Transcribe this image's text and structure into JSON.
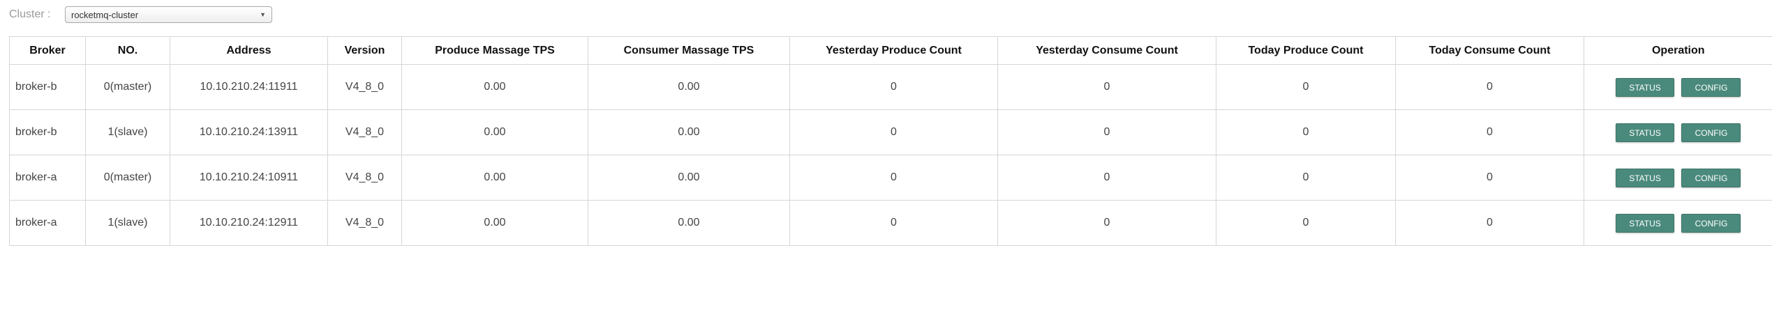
{
  "filter": {
    "label": "Cluster :",
    "selected": "rocketmq-cluster"
  },
  "table": {
    "headers": [
      "Broker",
      "NO.",
      "Address",
      "Version",
      "Produce Massage TPS",
      "Consumer Massage TPS",
      "Yesterday Produce Count",
      "Yesterday Consume Count",
      "Today Produce Count",
      "Today Consume Count",
      "Operation"
    ],
    "rows": [
      {
        "broker": "broker-b",
        "no": "0(master)",
        "address": "10.10.210.24:11911",
        "version": "V4_8_0",
        "produce_tps": "0.00",
        "consumer_tps": "0.00",
        "yesterday_produce": "0",
        "yesterday_consume": "0",
        "today_produce": "0",
        "today_consume": "0"
      },
      {
        "broker": "broker-b",
        "no": "1(slave)",
        "address": "10.10.210.24:13911",
        "version": "V4_8_0",
        "produce_tps": "0.00",
        "consumer_tps": "0.00",
        "yesterday_produce": "0",
        "yesterday_consume": "0",
        "today_produce": "0",
        "today_consume": "0"
      },
      {
        "broker": "broker-a",
        "no": "0(master)",
        "address": "10.10.210.24:10911",
        "version": "V4_8_0",
        "produce_tps": "0.00",
        "consumer_tps": "0.00",
        "yesterday_produce": "0",
        "yesterday_consume": "0",
        "today_produce": "0",
        "today_consume": "0"
      },
      {
        "broker": "broker-a",
        "no": "1(slave)",
        "address": "10.10.210.24:12911",
        "version": "V4_8_0",
        "produce_tps": "0.00",
        "consumer_tps": "0.00",
        "yesterday_produce": "0",
        "yesterday_consume": "0",
        "today_produce": "0",
        "today_consume": "0"
      }
    ],
    "actions": {
      "status_label": "STATUS",
      "config_label": "CONFIG"
    }
  },
  "colors": {
    "button": "#4a8a7c",
    "border": "#d6d6d6",
    "label": "#9a9a9a"
  }
}
